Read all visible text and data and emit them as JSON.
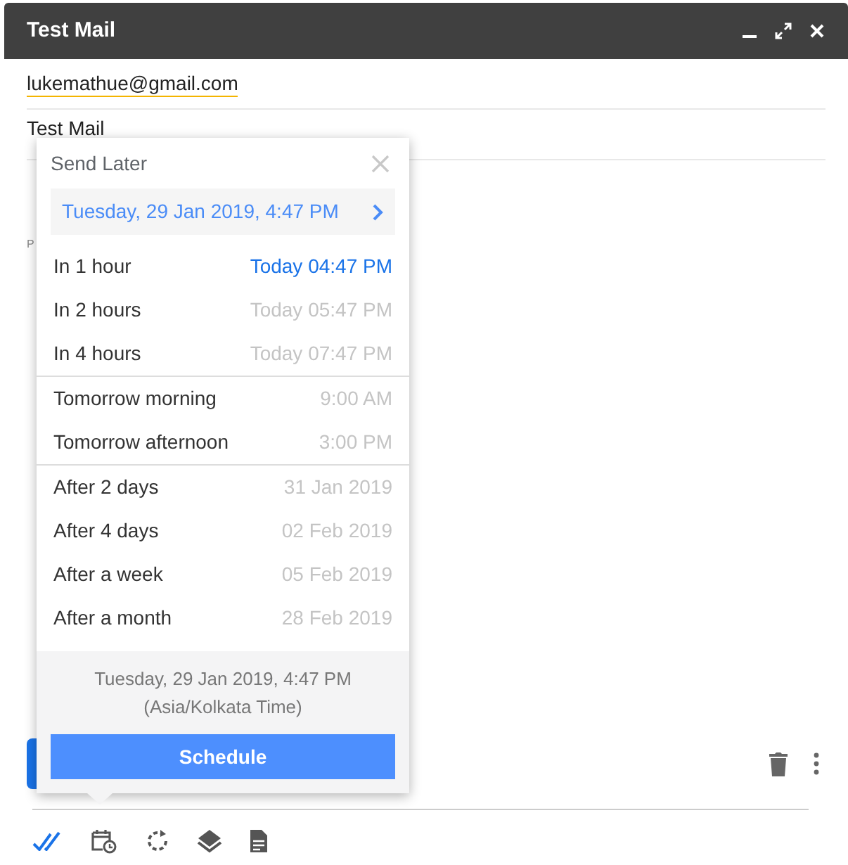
{
  "window": {
    "title": "Test Mail"
  },
  "to": "lukemathue@gmail.com",
  "subject": "Test Mail",
  "body_fragment": "P",
  "send_later": {
    "title": "Send Later",
    "custom_time": "Tuesday, 29 Jan 2019, 4:47 PM",
    "groups": [
      [
        {
          "label": "In 1 hour",
          "time": "Today 04:47 PM",
          "selected": true
        },
        {
          "label": "In 2 hours",
          "time": "Today 05:47 PM",
          "selected": false
        },
        {
          "label": "In 4 hours",
          "time": "Today 07:47 PM",
          "selected": false
        }
      ],
      [
        {
          "label": "Tomorrow morning",
          "time": "9:00 AM",
          "selected": false
        },
        {
          "label": "Tomorrow afternoon",
          "time": "3:00 PM",
          "selected": false
        }
      ],
      [
        {
          "label": "After 2 days",
          "time": "31 Jan 2019",
          "selected": false
        },
        {
          "label": "After 4 days",
          "time": "02 Feb 2019",
          "selected": false
        },
        {
          "label": "After a week",
          "time": "05 Feb 2019",
          "selected": false
        },
        {
          "label": "After a month",
          "time": "28 Feb 2019",
          "selected": false
        }
      ]
    ],
    "summary": "Tuesday, 29 Jan 2019, 4:47 PM",
    "timezone": "(Asia/Kolkata Time)",
    "button": "Schedule"
  }
}
